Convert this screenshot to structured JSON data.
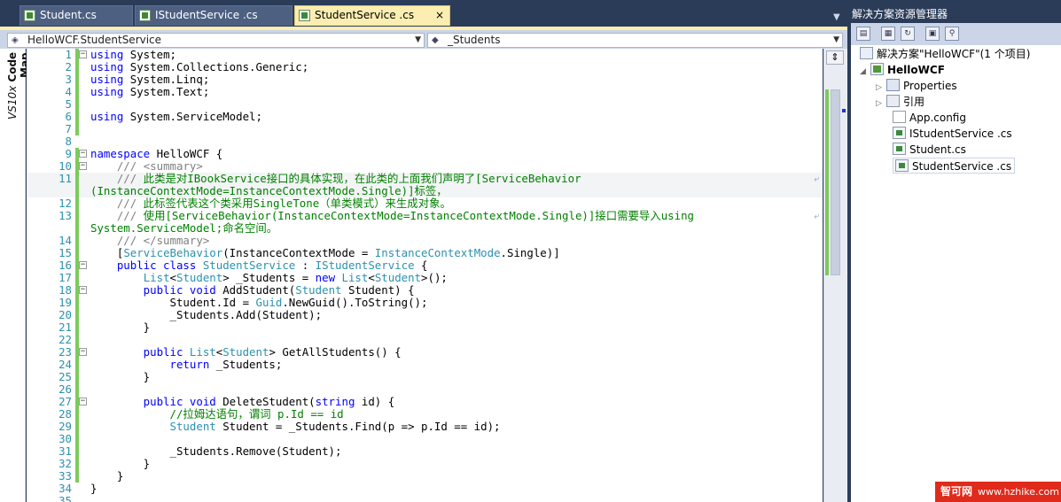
{
  "tabs": [
    {
      "label": "Student.cs",
      "active": false
    },
    {
      "label": "IStudentService .cs",
      "active": false
    },
    {
      "label": "StudentService .cs",
      "active": true
    }
  ],
  "tab_close": "×",
  "tab_dropdown": "▼",
  "nav": {
    "class_combo": "HelloWCF.StudentService",
    "member_combo": "_Students"
  },
  "code_map": {
    "prefix": "VS10x",
    "label": "Code Map"
  },
  "code_lines": [
    {
      "n": "1",
      "fold": "−",
      "chg": true,
      "parts": [
        [
          "k",
          "using"
        ],
        [
          "",
          "System;"
        ]
      ]
    },
    {
      "n": "2",
      "fold": "",
      "chg": true,
      "parts": [
        [
          "k",
          "using"
        ],
        [
          "",
          "System.Collections.Generic;"
        ]
      ]
    },
    {
      "n": "3",
      "fold": "",
      "chg": true,
      "parts": [
        [
          "k",
          "using"
        ],
        [
          "",
          "System.Linq;"
        ]
      ]
    },
    {
      "n": "4",
      "fold": "",
      "chg": true,
      "parts": [
        [
          "k",
          "using"
        ],
        [
          "",
          "System.Text;"
        ]
      ]
    },
    {
      "n": "5",
      "fold": "",
      "chg": true,
      "parts": []
    },
    {
      "n": "6",
      "fold": "",
      "chg": true,
      "parts": [
        [
          "k",
          "using"
        ],
        [
          "",
          "System.ServiceModel;"
        ]
      ]
    },
    {
      "n": "7",
      "fold": "",
      "chg": true,
      "parts": []
    },
    {
      "n": "8",
      "fold": "",
      "chg": false,
      "parts": []
    },
    {
      "n": "9",
      "fold": "−",
      "chg": true,
      "parts": [
        [
          "k",
          "namespace"
        ],
        [
          "",
          " HelloWCF {"
        ]
      ]
    },
    {
      "n": "10",
      "fold": "−",
      "chg": true,
      "parts": [
        [
          "g",
          "    ///"
        ],
        [
          "c",
          " "
        ],
        [
          "g",
          "<summary>"
        ]
      ]
    },
    {
      "n": "11",
      "fold": "",
      "chg": true,
      "hl": true,
      "wrap": true,
      "parts": [
        [
          "g",
          "    ///"
        ],
        [
          "c",
          " 此类是对IBookService接口的具体实现，在此类的上面我们声明了[ServiceBehavior"
        ]
      ]
    },
    {
      "n": "",
      "fold": "",
      "chg": true,
      "hl": true,
      "parts": [
        [
          "c",
          "(InstanceContextMode=InstanceContextMode.Single)]标签，"
        ]
      ]
    },
    {
      "n": "12",
      "fold": "",
      "chg": true,
      "parts": [
        [
          "g",
          "    ///"
        ],
        [
          "c",
          " 此标签代表这个类采用SingleTone（单类模式）来生成对象。"
        ]
      ]
    },
    {
      "n": "13",
      "fold": "",
      "chg": true,
      "wrap": true,
      "parts": [
        [
          "g",
          "    ///"
        ],
        [
          "c",
          " 使用[ServiceBehavior(InstanceContextMode=InstanceContextMode.Single)]接口需要导入using"
        ]
      ]
    },
    {
      "n": "",
      "fold": "",
      "chg": true,
      "parts": [
        [
          "c",
          "System.ServiceModel;命名空间。"
        ]
      ]
    },
    {
      "n": "14",
      "fold": "",
      "chg": true,
      "parts": [
        [
          "g",
          "    /// </summary>"
        ]
      ]
    },
    {
      "n": "15",
      "fold": "",
      "chg": true,
      "parts": [
        [
          "",
          "    ["
        ],
        [
          "t",
          "ServiceBehavior"
        ],
        [
          "",
          "(InstanceContextMode = "
        ],
        [
          "t",
          "InstanceContextMode"
        ],
        [
          "",
          ".Single)]"
        ]
      ]
    },
    {
      "n": "16",
      "fold": "−",
      "chg": true,
      "parts": [
        [
          "k",
          "    public class "
        ],
        [
          "t",
          "StudentService"
        ],
        [
          "",
          " : "
        ],
        [
          "t",
          "IStudentService"
        ],
        [
          "",
          " {"
        ]
      ]
    },
    {
      "n": "17",
      "fold": "",
      "chg": true,
      "parts": [
        [
          "",
          "        "
        ],
        [
          "t",
          "List"
        ],
        [
          "",
          "<"
        ],
        [
          "t",
          "Student"
        ],
        [
          "",
          "> _Students = "
        ],
        [
          "k",
          "new "
        ],
        [
          "t",
          "List"
        ],
        [
          "",
          "<"
        ],
        [
          "t",
          "Student"
        ],
        [
          "",
          ">();"
        ]
      ]
    },
    {
      "n": "18",
      "fold": "−",
      "chg": true,
      "parts": [
        [
          "k",
          "        public void "
        ],
        [
          "",
          "AddStudent("
        ],
        [
          "t",
          "Student"
        ],
        [
          "",
          " Student) {"
        ]
      ]
    },
    {
      "n": "19",
      "fold": "",
      "chg": true,
      "parts": [
        [
          "",
          "            Student.Id = "
        ],
        [
          "t",
          "Guid"
        ],
        [
          "",
          ".NewGuid().ToString();"
        ]
      ]
    },
    {
      "n": "20",
      "fold": "",
      "chg": true,
      "parts": [
        [
          "",
          "            _Students.Add(Student);"
        ]
      ]
    },
    {
      "n": "21",
      "fold": "",
      "chg": true,
      "parts": [
        [
          "",
          "        }"
        ]
      ]
    },
    {
      "n": "22",
      "fold": "",
      "chg": true,
      "parts": []
    },
    {
      "n": "23",
      "fold": "−",
      "chg": true,
      "parts": [
        [
          "k",
          "        public "
        ],
        [
          "t",
          "List"
        ],
        [
          "",
          "<"
        ],
        [
          "t",
          "Student"
        ],
        [
          "",
          "> GetAllStudents() {"
        ]
      ]
    },
    {
      "n": "24",
      "fold": "",
      "chg": true,
      "parts": [
        [
          "k",
          "            return"
        ],
        [
          "",
          " _Students;"
        ]
      ]
    },
    {
      "n": "25",
      "fold": "",
      "chg": true,
      "parts": [
        [
          "",
          "        }"
        ]
      ]
    },
    {
      "n": "26",
      "fold": "",
      "chg": true,
      "parts": []
    },
    {
      "n": "27",
      "fold": "−",
      "chg": true,
      "parts": [
        [
          "k",
          "        public void "
        ],
        [
          "",
          "DeleteStudent("
        ],
        [
          "k",
          "string"
        ],
        [
          "",
          " id) {"
        ]
      ]
    },
    {
      "n": "28",
      "fold": "",
      "chg": true,
      "parts": [
        [
          "c",
          "            //拉姆达语句，谓词 p.Id == id"
        ]
      ]
    },
    {
      "n": "29",
      "fold": "",
      "chg": true,
      "parts": [
        [
          "t",
          "            Student"
        ],
        [
          "",
          " Student = _Students.Find(p => p.Id == id);"
        ]
      ]
    },
    {
      "n": "30",
      "fold": "",
      "chg": true,
      "parts": []
    },
    {
      "n": "31",
      "fold": "",
      "chg": true,
      "parts": [
        [
          "",
          "            _Students.Remove(Student);"
        ]
      ]
    },
    {
      "n": "32",
      "fold": "",
      "chg": true,
      "parts": [
        [
          "",
          "        }"
        ]
      ]
    },
    {
      "n": "33",
      "fold": "",
      "chg": true,
      "parts": [
        [
          "",
          "    }"
        ]
      ]
    },
    {
      "n": "34",
      "fold": "",
      "chg": false,
      "parts": [
        [
          "",
          "}"
        ]
      ]
    },
    {
      "n": "35",
      "fold": "",
      "chg": false,
      "parts": []
    }
  ],
  "split_button": "⇕",
  "solution_explorer": {
    "title": "解决方案资源管理器",
    "solution": "解决方案\"HelloWCF\"(1 个项目)",
    "project": "HelloWCF",
    "items": [
      {
        "label": "Properties",
        "icon": "folder-icon",
        "expand": "▷"
      },
      {
        "label": "引用",
        "icon": "references-icon",
        "expand": "▷"
      },
      {
        "label": "App.config",
        "icon": "config-file-icon",
        "expand": ""
      },
      {
        "label": "IStudentService .cs",
        "icon": "cs-file-icon",
        "expand": ""
      },
      {
        "label": "Student.cs",
        "icon": "cs-file-icon",
        "expand": ""
      },
      {
        "label": "StudentService .cs",
        "icon": "cs-file-icon",
        "expand": "",
        "selected": true
      }
    ],
    "toolbar_icons": [
      "properties-icon",
      "show-all-files-icon",
      "refresh-icon",
      "view-code-icon",
      "class-diagram-icon"
    ]
  },
  "watermark": {
    "brand": "智可网",
    "url": "www.hzhike.com"
  }
}
